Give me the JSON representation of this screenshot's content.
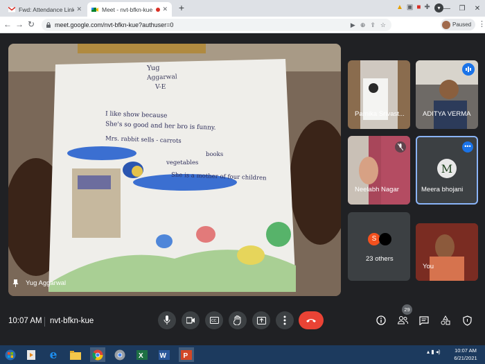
{
  "browser": {
    "tabs": [
      {
        "title": "Fwd: Attendance Link for III - IV",
        "active": false
      },
      {
        "title": "Meet - nvt-bfkn-kue",
        "active": true
      }
    ],
    "url": "meet.google.com/nvt-bfkn-kue?authuser=0",
    "profile_label": "Paused"
  },
  "meet": {
    "main_speaker": "Yug Aggarwal",
    "drawing_text": {
      "name": "Yug",
      "surname": "Aggarwal",
      "class": "V-E",
      "line1": "I like show because",
      "line2": "She's so good and her bro is funny.",
      "line3": "Mrs. rabbit sells - carrots",
      "line4": "books",
      "line5": "vegetables",
      "line6": "She is a mother of four children"
    },
    "participants": [
      {
        "name": "Parnika Srivast..."
      },
      {
        "name": "ADITYA VERMA"
      },
      {
        "name": "Neelabh Nagar"
      },
      {
        "name": "Meera bhojani",
        "initial": "M"
      },
      {
        "name": "23 others",
        "initial": "S"
      },
      {
        "name": "You"
      }
    ],
    "time": "10:07 AM",
    "meeting_code": "nvt-bfkn-kue",
    "people_count": "29"
  },
  "taskbar": {
    "time": "10:07 AM",
    "date": "6/21/2021"
  },
  "colors": {
    "meet_bg": "#202124",
    "end_call": "#ea4335",
    "accent_blue": "#8ab4f8",
    "taskbar": "#1c3a5e"
  }
}
